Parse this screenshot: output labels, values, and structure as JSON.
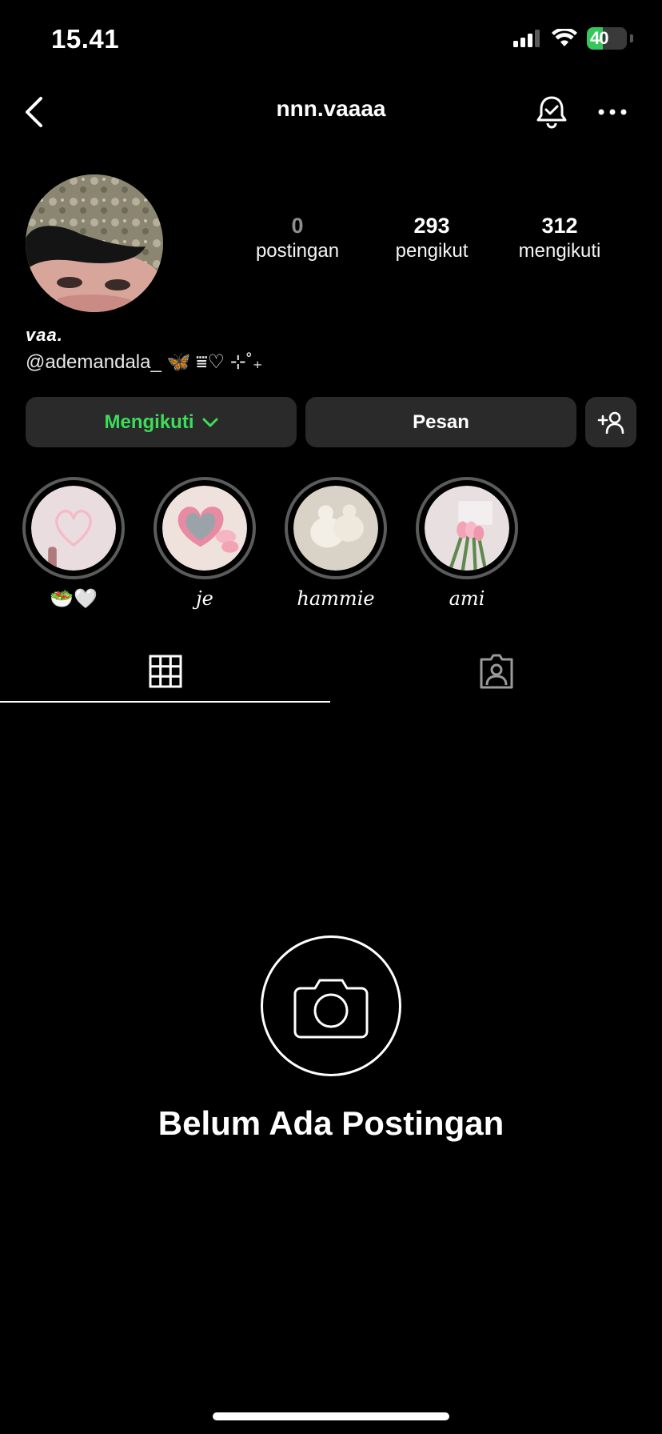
{
  "status_bar": {
    "time": "15.41",
    "battery": "40",
    "battery_level": 0.4,
    "battery_color": "#34c759"
  },
  "header": {
    "username": "nnn.vaaaa",
    "back_icon": "chevron-left-icon",
    "notification_icon": "bell-check-icon",
    "more_icon": "ellipsis-icon"
  },
  "profile": {
    "stats": [
      {
        "value": "0",
        "label": "postingan"
      },
      {
        "value": "293",
        "label": "pengikut"
      },
      {
        "value": "312",
        "label": "mengikuti"
      }
    ],
    "display_name": "vaa.",
    "bio": "@ademandala_ 🦋 ⩸♡ ⊹˚₊"
  },
  "actions": {
    "follow_label": "Mengikuti",
    "follow_color": "#3ddc5a",
    "message_label": "Pesan",
    "add_user_icon": "add-person-icon"
  },
  "highlights": [
    {
      "label": "🥗🤍"
    },
    {
      "label": "je"
    },
    {
      "label": "hammie"
    },
    {
      "label": "ami"
    }
  ],
  "tabs": {
    "grid_icon": "grid-icon",
    "tagged_icon": "tagged-person-icon"
  },
  "empty_state": {
    "icon": "camera-icon",
    "title": "Belum Ada Postingan"
  }
}
